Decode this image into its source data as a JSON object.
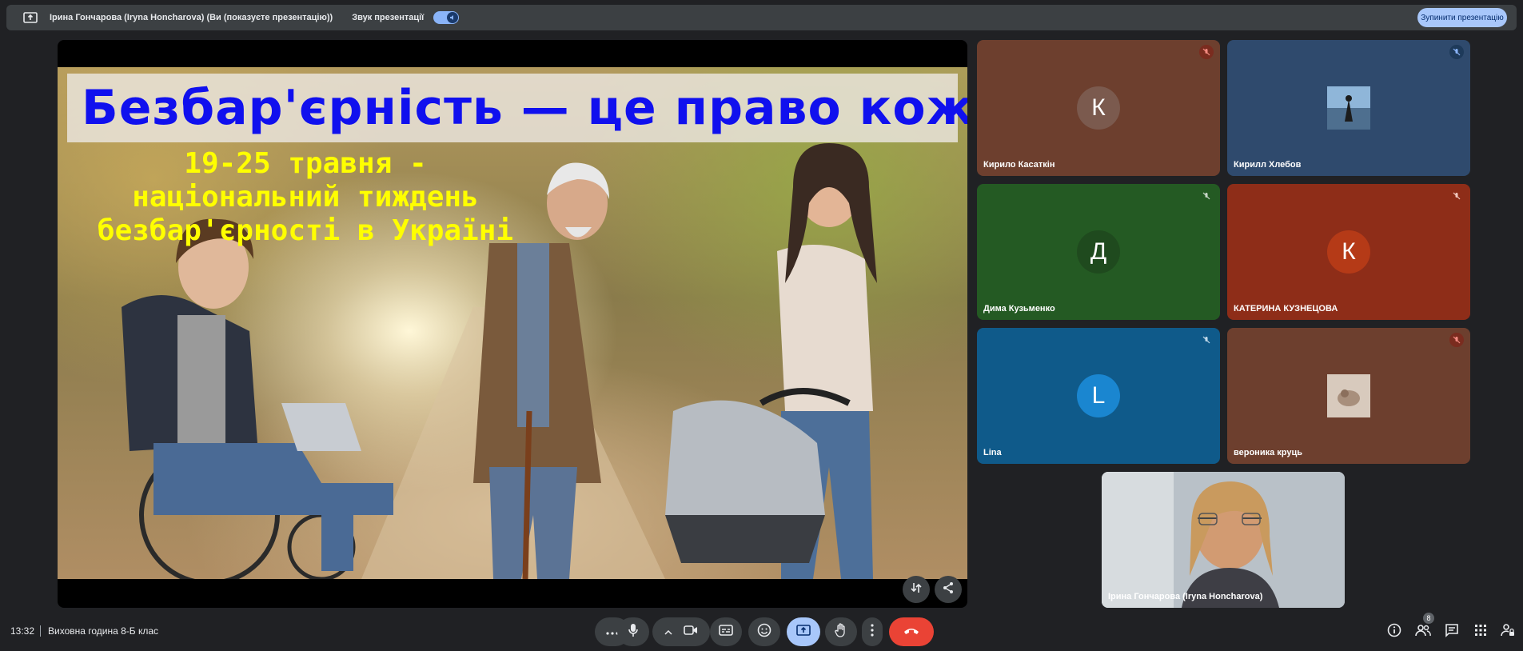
{
  "topbar": {
    "presenter": "Ірина Гончарова (Iryna Honcharova) (Ви (показуєте презентацію))",
    "sound_label": "Звук презентації",
    "stop_button": "Зупинити презентацію"
  },
  "slide": {
    "title": "Безбар'єрність — це право кожного",
    "subtitle": "19-25 травня - національний тиждень безбар'єрності в Україні"
  },
  "participants": [
    {
      "name": "Кирило Касаткін",
      "initial": "К",
      "bg": "#6d3f2e",
      "avatar_bg": "#7b5a4e"
    },
    {
      "name": "Кирилл Хлебов",
      "initial": "",
      "bg": "#2f4a6d",
      "avatar_bg": "#6b8db5"
    },
    {
      "name": "Дима Кузьменко",
      "initial": "Д",
      "bg": "#245a23",
      "avatar_bg": "#1f4a1e"
    },
    {
      "name": "КАТЕРИНА КУЗНЕЦОВА",
      "initial": "К",
      "bg": "#8e2d18",
      "avatar_bg": "#b53a17"
    },
    {
      "name": "Lina",
      "initial": "L",
      "bg": "#0f5a8a",
      "avatar_bg": "#1a86d0"
    },
    {
      "name": "вероника круць",
      "initial": "",
      "bg": "#6d3f2e",
      "avatar_bg": "#c9b7a8"
    },
    {
      "name": "Ірина Гончарова (Iryna Honcharova)",
      "initial": "",
      "bg": "#9aa3ab",
      "avatar_bg": ""
    }
  ],
  "bottom": {
    "time": "13:32",
    "meeting_title": "Виховна година 8-Б клас",
    "participants_count": "8"
  },
  "colors": {
    "background": "#202124",
    "accent": "#8ab4f8",
    "end_call": "#ea4335"
  }
}
